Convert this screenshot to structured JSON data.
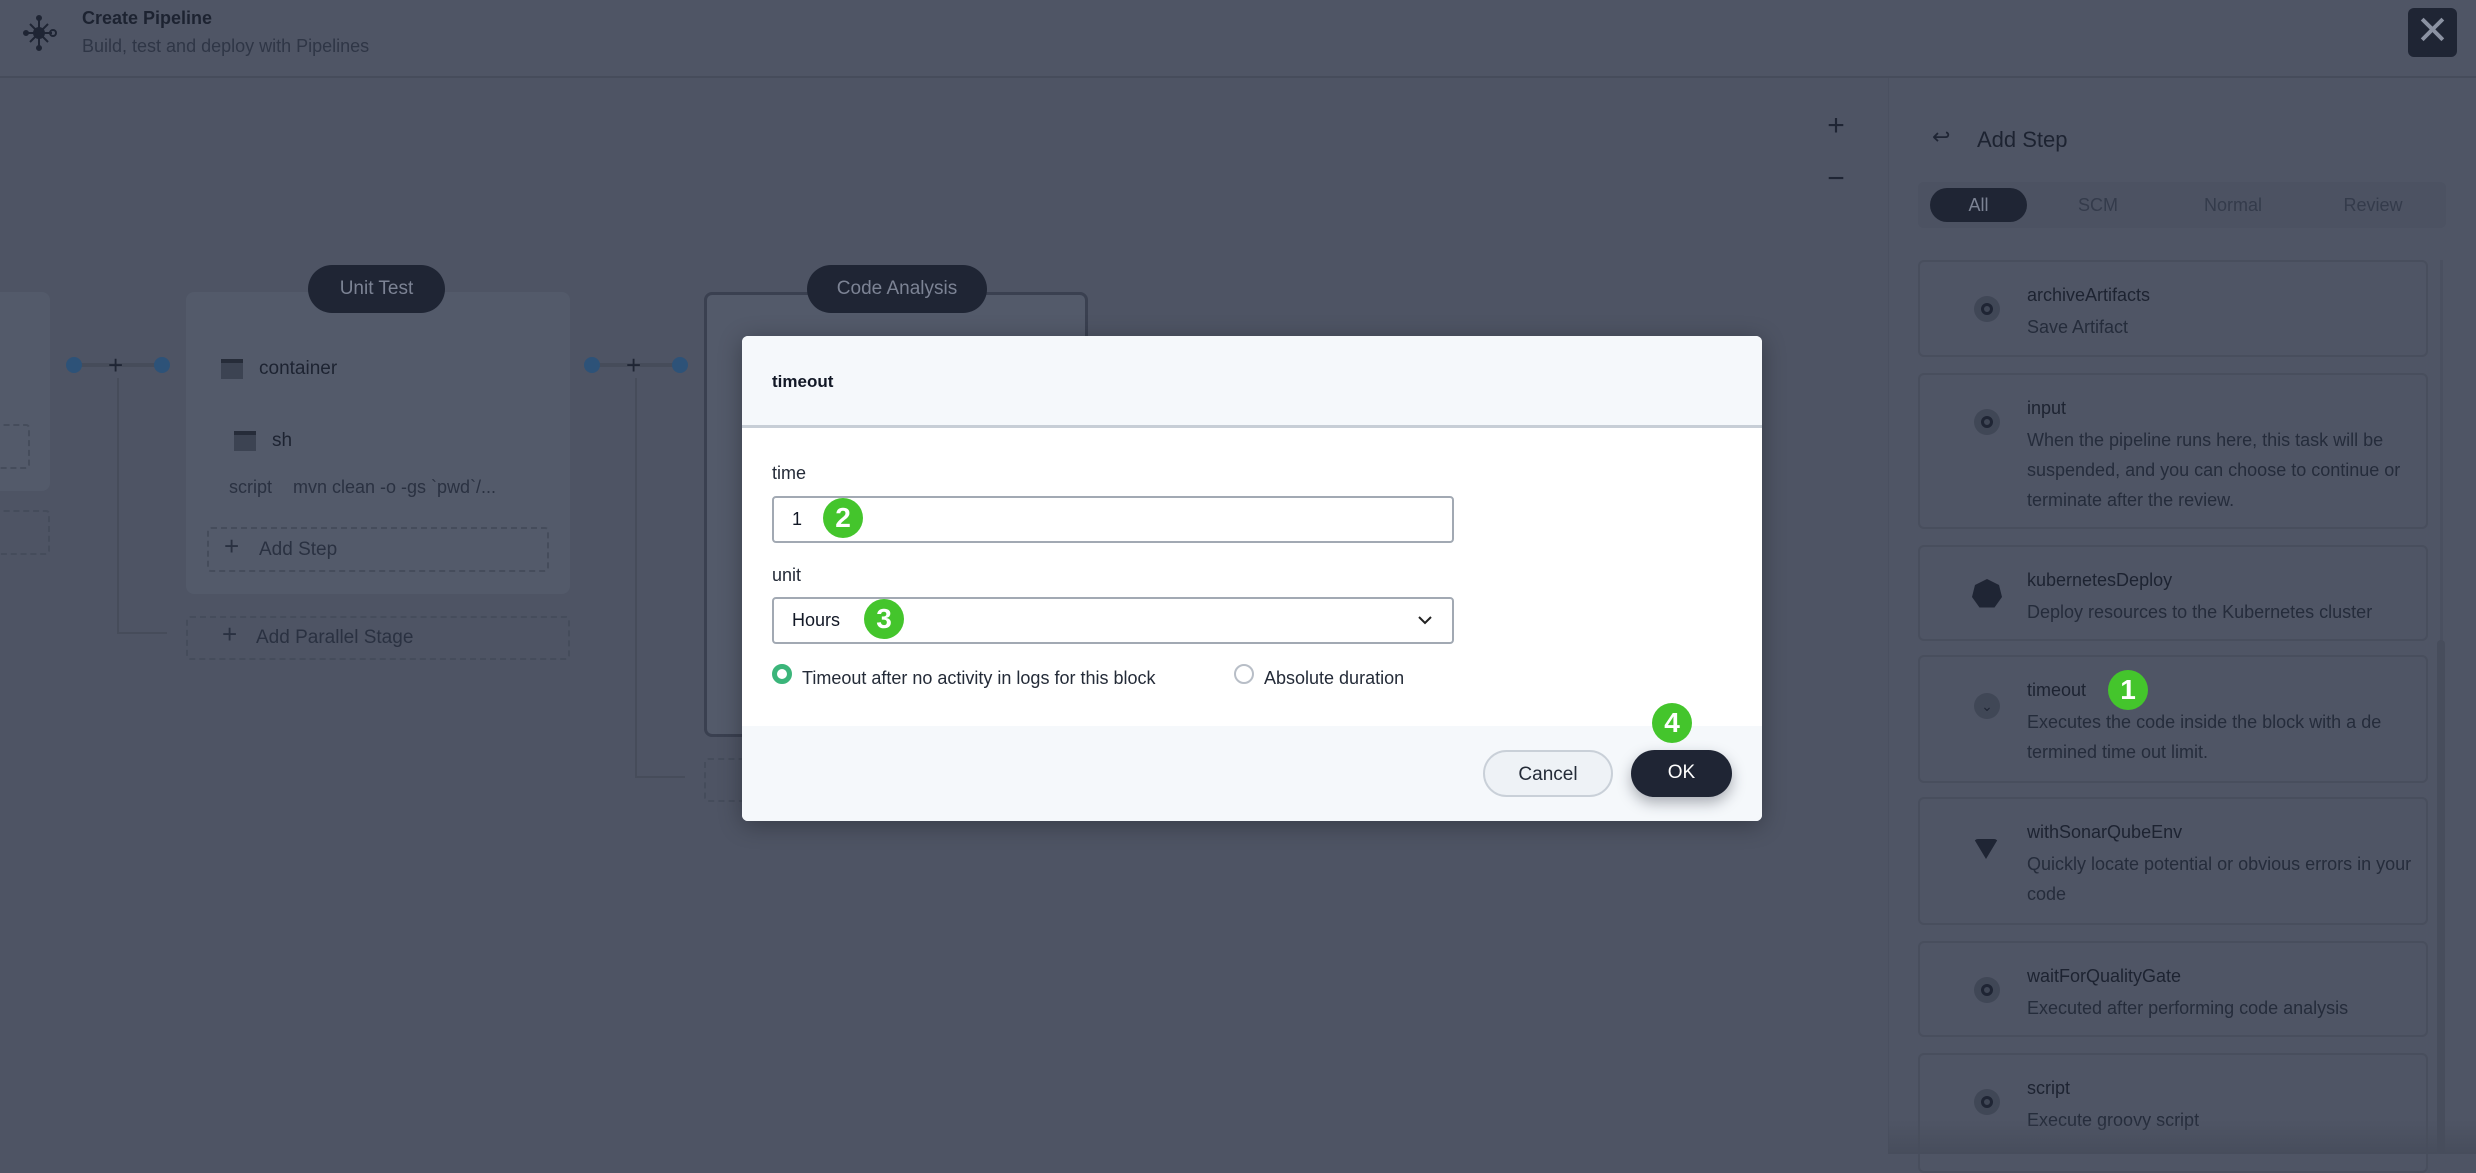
{
  "header": {
    "title": "Create Pipeline",
    "subtitle": "Build, test and deploy with Pipelines",
    "close_icon": "close-icon",
    "logo_icon": "pipeline-logo-icon"
  },
  "canvas": {
    "zoom_in": "+",
    "zoom_out": "−",
    "stages": [
      {
        "name": "Unit Test",
        "steps": [
          {
            "name": "container"
          },
          {
            "name": "sh",
            "param_key": "script",
            "param_value": "mvn clean -o -gs `pwd`/..."
          }
        ],
        "add_step": "Add Step",
        "add_parallel": "Add Parallel Stage"
      },
      {
        "name": "Code Analysis"
      }
    ],
    "plus": "+"
  },
  "panel": {
    "title": "Add Step",
    "tabs": [
      {
        "label": "All",
        "active": true
      },
      {
        "label": "SCM"
      },
      {
        "label": "Normal"
      },
      {
        "label": "Review"
      }
    ],
    "steps": [
      {
        "name": "archiveArtifacts",
        "desc": "Save Artifact",
        "icon": "step-icon"
      },
      {
        "name": "input",
        "desc": "When the pipeline runs here, this task will be suspended, and you can choose to continue or terminate after the review.",
        "icon": "step-icon"
      },
      {
        "name": "kubernetesDeploy",
        "desc": "Deploy resources to the Kubernetes cluster",
        "icon": "kubernetes-icon"
      },
      {
        "name": "timeout",
        "desc": "Executes the code inside the block with a de termined time out limit.",
        "icon": "chevron-down-icon"
      },
      {
        "name": "withSonarQubeEnv",
        "desc": "Quickly locate potential or obvious errors in your code",
        "icon": "sonarqube-icon"
      },
      {
        "name": "waitForQualityGate",
        "desc": "Executed after performing code analysis",
        "icon": "step-icon"
      },
      {
        "name": "script",
        "desc": "Execute groovy script",
        "icon": "step-icon"
      }
    ]
  },
  "modal": {
    "title": "timeout",
    "time_label": "time",
    "time_value": "1",
    "unit_label": "unit",
    "unit_value": "Hours",
    "radio_options": [
      {
        "label": "Timeout after no activity in logs for this block",
        "checked": true
      },
      {
        "label": "Absolute duration",
        "checked": false
      }
    ],
    "cancel": "Cancel",
    "ok": "OK"
  },
  "badges": [
    "1",
    "2",
    "3",
    "4"
  ],
  "colors": {
    "badge": "#44c52c",
    "primary_button": "#1f2534",
    "radio_checked": "#3bb57a"
  }
}
